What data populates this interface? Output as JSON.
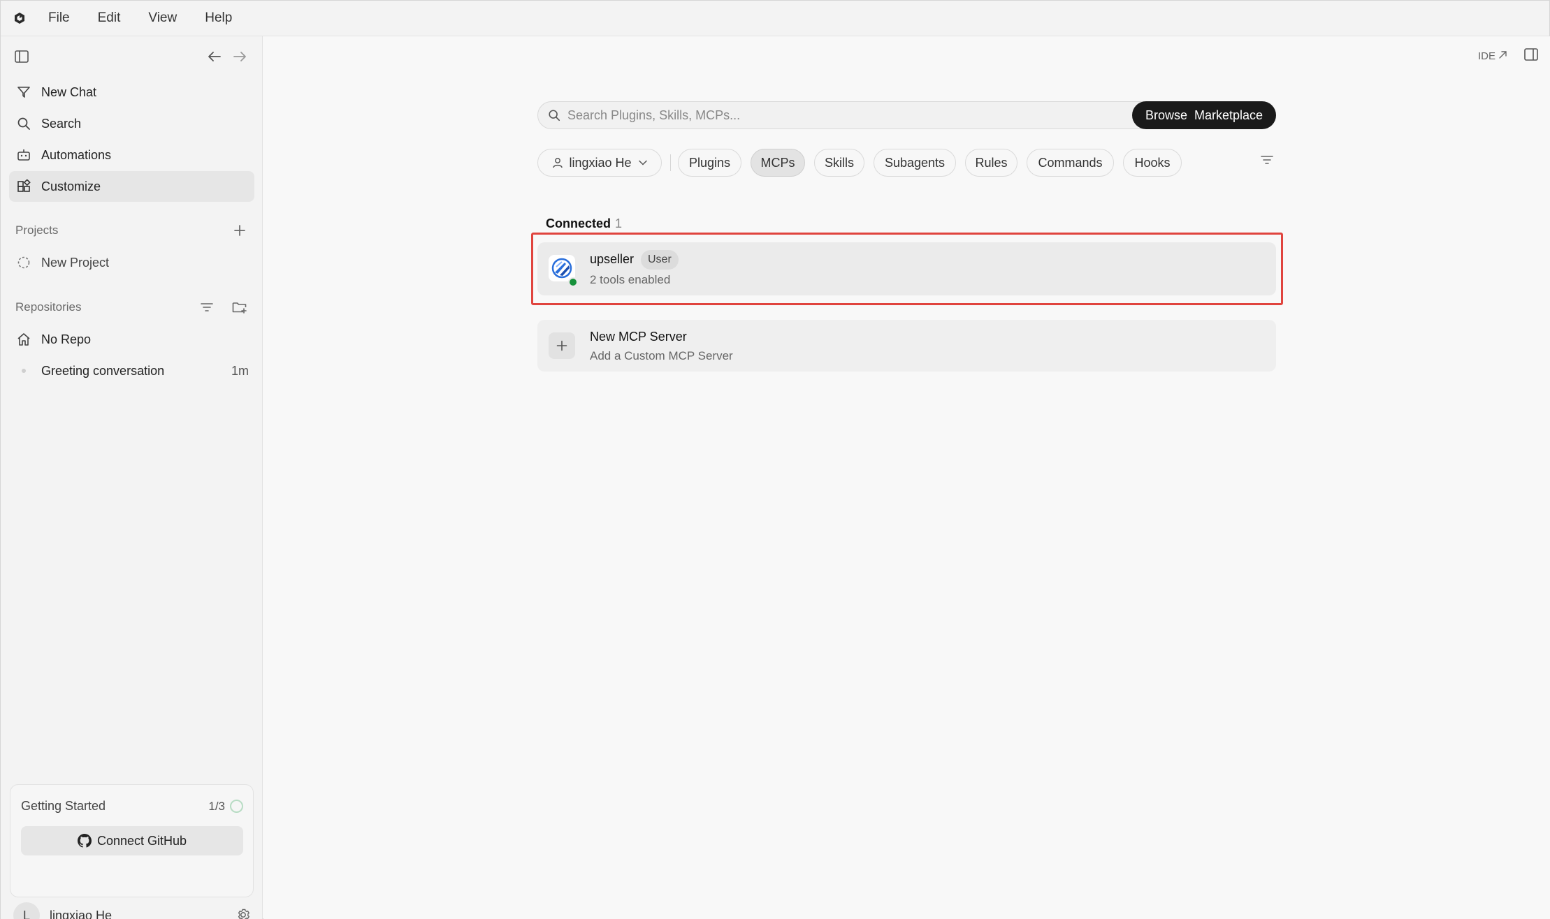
{
  "menubar": {
    "items": [
      "File",
      "Edit",
      "View",
      "Help"
    ]
  },
  "sidebar": {
    "nav": [
      {
        "label": "New Chat",
        "icon": "new-chat-icon"
      },
      {
        "label": "Search",
        "icon": "search-icon"
      },
      {
        "label": "Automations",
        "icon": "automations-icon"
      },
      {
        "label": "Customize",
        "icon": "customize-icon",
        "active": true
      }
    ],
    "projects_label": "Projects",
    "projects": [
      {
        "label": "New Project",
        "icon": "dashed-circle-icon"
      }
    ],
    "repositories_label": "Repositories",
    "repositories": [
      {
        "label": "No Repo",
        "icon": "home-icon"
      },
      {
        "label": "Greeting conversation",
        "time": "1m"
      }
    ],
    "getting_started": {
      "title": "Getting Started",
      "count": "1/3",
      "button": "Connect GitHub"
    },
    "user": {
      "initial": "L",
      "name": "lingxiao He"
    }
  },
  "main": {
    "ide_label": "IDE",
    "search_placeholder": "Search Plugins, Skills, MCPs...",
    "browse_button": "Browse  Marketplace",
    "filters": {
      "user_chip": "lingxiao He",
      "chips": [
        "Plugins",
        "MCPs",
        "Skills",
        "Subagents",
        "Rules",
        "Commands",
        "Hooks"
      ],
      "active": "MCPs"
    },
    "connected": {
      "label": "Connected",
      "count": "1"
    },
    "servers": [
      {
        "name": "upseller",
        "badge": "User",
        "subtitle": "2 tools enabled",
        "status": "connected",
        "status_color": "#17913b"
      }
    ],
    "new_server": {
      "title": "New MCP Server",
      "subtitle": "Add a Custom MCP Server"
    },
    "highlight_color": "#e0443e"
  }
}
